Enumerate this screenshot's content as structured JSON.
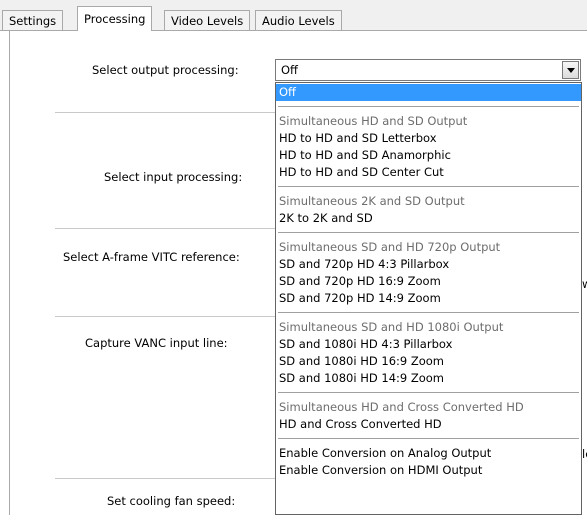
{
  "tabs": [
    {
      "label": "Settings"
    },
    {
      "label": "Processing"
    },
    {
      "label": "Video Levels"
    },
    {
      "label": "Audio Levels"
    }
  ],
  "labels": {
    "output_processing": "Select output processing:",
    "input_processing": "Select input processing:",
    "aframe_vitc": "Select A-frame VITC reference:",
    "capture_vanc": "Capture VANC input line:",
    "cooling_fan": "Set cooling fan speed:"
  },
  "peeks": {
    "row_w": "w",
    "row_le": "le"
  },
  "combo": {
    "value": "Off"
  },
  "dropdown": {
    "items": [
      {
        "text": "Off",
        "type": "selected"
      },
      {
        "type": "separator"
      },
      {
        "text": "Simultaneous HD and SD Output",
        "type": "header"
      },
      {
        "text": "HD to HD and SD Letterbox",
        "type": "option"
      },
      {
        "text": "HD to HD and SD Anamorphic",
        "type": "option"
      },
      {
        "text": "HD to HD and SD Center Cut",
        "type": "option"
      },
      {
        "type": "separator"
      },
      {
        "text": "Simultaneous 2K and SD Output",
        "type": "header"
      },
      {
        "text": "2K to 2K and SD",
        "type": "option"
      },
      {
        "type": "separator"
      },
      {
        "text": "Simultaneous SD and HD 720p Output",
        "type": "header"
      },
      {
        "text": "SD and 720p HD 4:3 Pillarbox",
        "type": "option"
      },
      {
        "text": "SD and 720p HD 16:9 Zoom",
        "type": "option"
      },
      {
        "text": "SD and 720p HD 14:9 Zoom",
        "type": "option"
      },
      {
        "type": "separator"
      },
      {
        "text": "Simultaneous SD and HD 1080i Output",
        "type": "header"
      },
      {
        "text": "SD and 1080i HD 4:3 Pillarbox",
        "type": "option"
      },
      {
        "text": "SD and 1080i HD 16:9 Zoom",
        "type": "option"
      },
      {
        "text": "SD and 1080i HD 14:9 Zoom",
        "type": "option"
      },
      {
        "type": "separator"
      },
      {
        "text": "Simultaneous HD and Cross Converted HD",
        "type": "header"
      },
      {
        "text": "HD and Cross Converted HD",
        "type": "option"
      },
      {
        "type": "separator"
      },
      {
        "text": "Enable Conversion on Analog Output",
        "type": "option"
      },
      {
        "text": "Enable Conversion on HDMI Output",
        "type": "option"
      }
    ]
  },
  "colors": {
    "selection": "#3399ff",
    "header_text": "#6d6d6d"
  }
}
